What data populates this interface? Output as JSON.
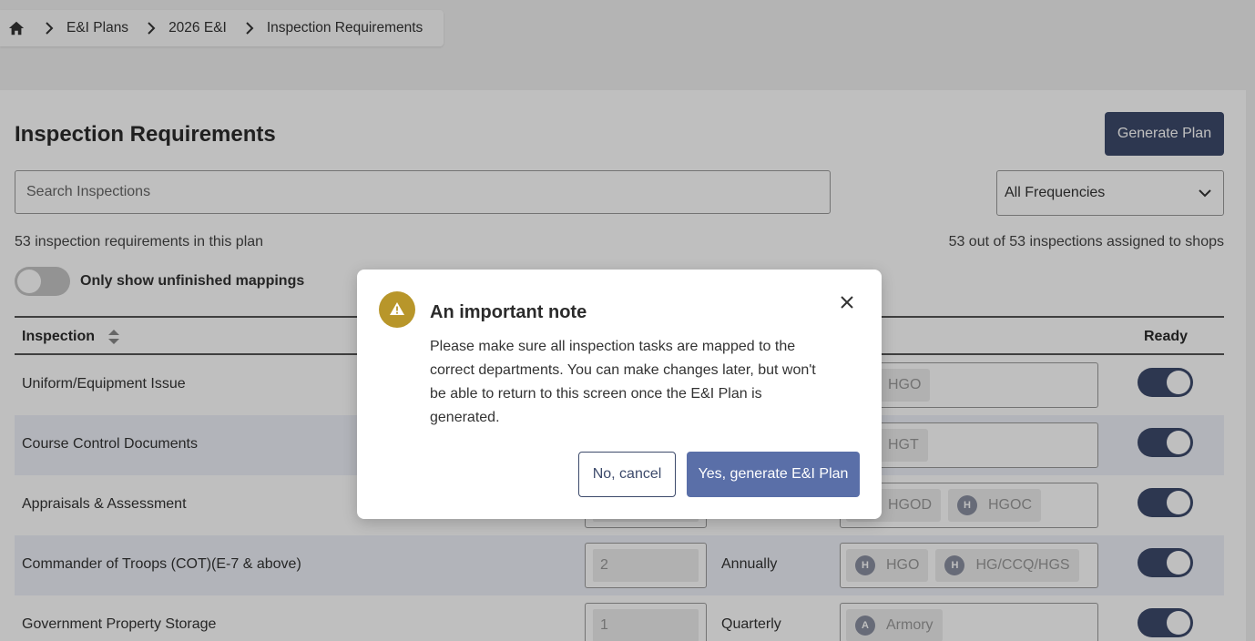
{
  "breadcrumb": {
    "items": [
      "E&I Plans",
      "2026 E&I",
      "Inspection Requirements"
    ]
  },
  "page": {
    "title": "Inspection Requirements",
    "generate_button": "Generate Plan",
    "search_placeholder": "Search Inspections",
    "frequency_filter": "All Frequencies",
    "count_text": "53 inspection requirements in this plan",
    "assigned_text": "53 out of 53 inspections assigned to shops",
    "toggle_label": "Only show unfinished mappings",
    "toggle_on": false
  },
  "table": {
    "headers": {
      "inspection": "Inspection",
      "ready": "Ready"
    },
    "rows": [
      {
        "name": "Uniform/Equipment Issue",
        "qty": "",
        "frequency": "",
        "shops": [
          {
            "initial": "",
            "label": "HGO"
          }
        ],
        "ready": true
      },
      {
        "name": "Course Control Documents",
        "qty": "",
        "frequency": "",
        "shops": [
          {
            "initial": "",
            "label": "HGT"
          }
        ],
        "ready": true
      },
      {
        "name": "Appraisals & Assessment",
        "qty": "",
        "frequency": "",
        "shops": [
          {
            "initial": "",
            "label": "HGOD"
          },
          {
            "initial": "H",
            "label": "HGOC"
          }
        ],
        "ready": true
      },
      {
        "name": "Commander of Troops (COT)(E-7 & above)",
        "qty": "2",
        "frequency": "Annually",
        "shops": [
          {
            "initial": "H",
            "label": "HGO"
          },
          {
            "initial": "H",
            "label": "HG/CCQ/HGS"
          }
        ],
        "ready": true
      },
      {
        "name": "Government Property Storage",
        "qty": "1",
        "frequency": "Quarterly",
        "shops": [
          {
            "initial": "A",
            "label": "Armory"
          }
        ],
        "ready": true
      }
    ]
  },
  "modal": {
    "title": "An important note",
    "body": "Please make sure all inspection tasks are mapped to the correct departments. You can make changes later, but won't be able to return to this screen once the E&I Plan is generated.",
    "cancel_label": "No, cancel",
    "confirm_label": "Yes, generate E&I Plan"
  },
  "colors": {
    "primary": "#3d4a6b",
    "confirm": "#5a6fa8",
    "warning": "#b8962a"
  }
}
